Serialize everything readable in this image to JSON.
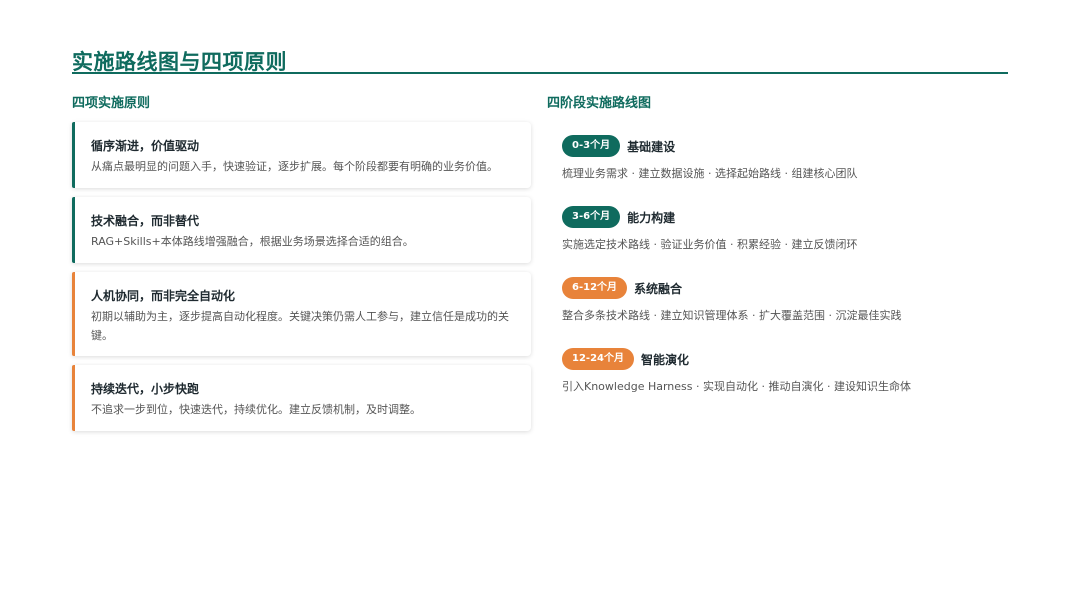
{
  "page": {
    "title": "实施路线图与四项原则"
  },
  "principles": {
    "heading": "四项实施原则",
    "items": [
      {
        "title": "循序渐进，价值驱动",
        "desc": "从痛点最明显的问题入手，快速验证，逐步扩展。每个阶段都要有明确的业务价值。",
        "accent": "#0f6b5e"
      },
      {
        "title": "技术融合，而非替代",
        "desc": "RAG+Skills+本体路线增强融合，根据业务场景选择合适的组合。",
        "accent": "#0f6b5e"
      },
      {
        "title": "人机协同，而非完全自动化",
        "desc": "初期以辅助为主，逐步提高自动化程度。关键决策仍需人工参与，建立信任是成功的关键。",
        "accent": "#e8833a"
      },
      {
        "title": "持续迭代，小步快跑",
        "desc": "不追求一步到位，快速迭代，持续优化。建立反馈机制，及时调整。",
        "accent": "#e8833a"
      }
    ]
  },
  "roadmap": {
    "heading": "四阶段实施路线图",
    "phases": [
      {
        "badge": "0-3个月",
        "name": "基础建设",
        "desc": "梳理业务需求 · 建立数据设施 · 选择起始路线 · 组建核心团队",
        "color": "#0f6b5e"
      },
      {
        "badge": "3-6个月",
        "name": "能力构建",
        "desc": "实施选定技术路线 · 验证业务价值 · 积累经验 · 建立反馈闭环",
        "color": "#0f6b5e"
      },
      {
        "badge": "6-12个月",
        "name": "系统融合",
        "desc": "整合多条技术路线 · 建立知识管理体系 · 扩大覆盖范围 · 沉淀最佳实践",
        "color": "#e8833a"
      },
      {
        "badge": "12-24个月",
        "name": "智能演化",
        "desc": "引入Knowledge Harness · 实现自动化 · 推动自演化 · 建设知识生命体",
        "color": "#e8833a"
      }
    ]
  }
}
